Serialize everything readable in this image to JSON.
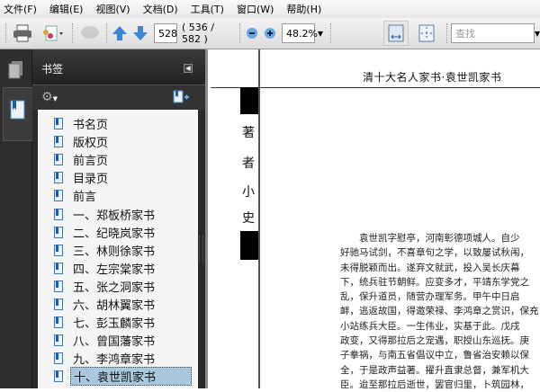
{
  "menu": [
    "文件(F)",
    "编辑(E)",
    "视图(V)",
    "文档(D)",
    "工具(T)",
    "窗口(W)",
    "帮助(H)"
  ],
  "toolbar": {
    "page_input": "528",
    "page_count": "( 536 / 582 )",
    "zoom": "48.2%",
    "search_placeholder": "查找"
  },
  "bookmarks": {
    "title": "书签",
    "items": [
      "书名页",
      "版权页",
      "前言页",
      "目录页",
      "前言",
      "一、郑板桥家书",
      "二、纪晓岚家书",
      "三、林则徐家书",
      "四、左宗棠家书",
      "五、张之洞家书",
      "六、胡林翼家书",
      "七、彭玉麟家书",
      "八、曾国藩家书",
      "九、李鸿章家书",
      "十、袁世凯家书"
    ],
    "selected_index": 14
  },
  "page": {
    "running_head": "清十大名人家书·袁世凯家书",
    "side_title": [
      "著",
      "者",
      "小",
      "史"
    ],
    "lines": [
      "　　袁世凯字慰亭，河南彰德项城人。自少",
      "好驰马试剑，不喜章句之学，以致屡试秋闱，",
      "未得脱颖而出。遂弃文就武，投入吴长庆幕",
      "下，统兵驻节朝鲜。应变多才，平靖东学党之",
      "乱，保升道员，随营办理军务。甲午中日启",
      "衅，逃返故国，得邀荣禄、李鸿章之赏识，保充",
      "小站练兵大臣。一生伟业，实基于此。戊戌",
      "政变，又得那拉后之宠遇，职授山东巡抚。庚",
      "子拳祸，与南五省倡议中立，鲁省治安赖以保",
      "全，于是政声益著。擢升直隶总督，兼军机大",
      "臣。迨至那拉后逝世，罢官归里，卜筑园林，"
    ]
  }
}
